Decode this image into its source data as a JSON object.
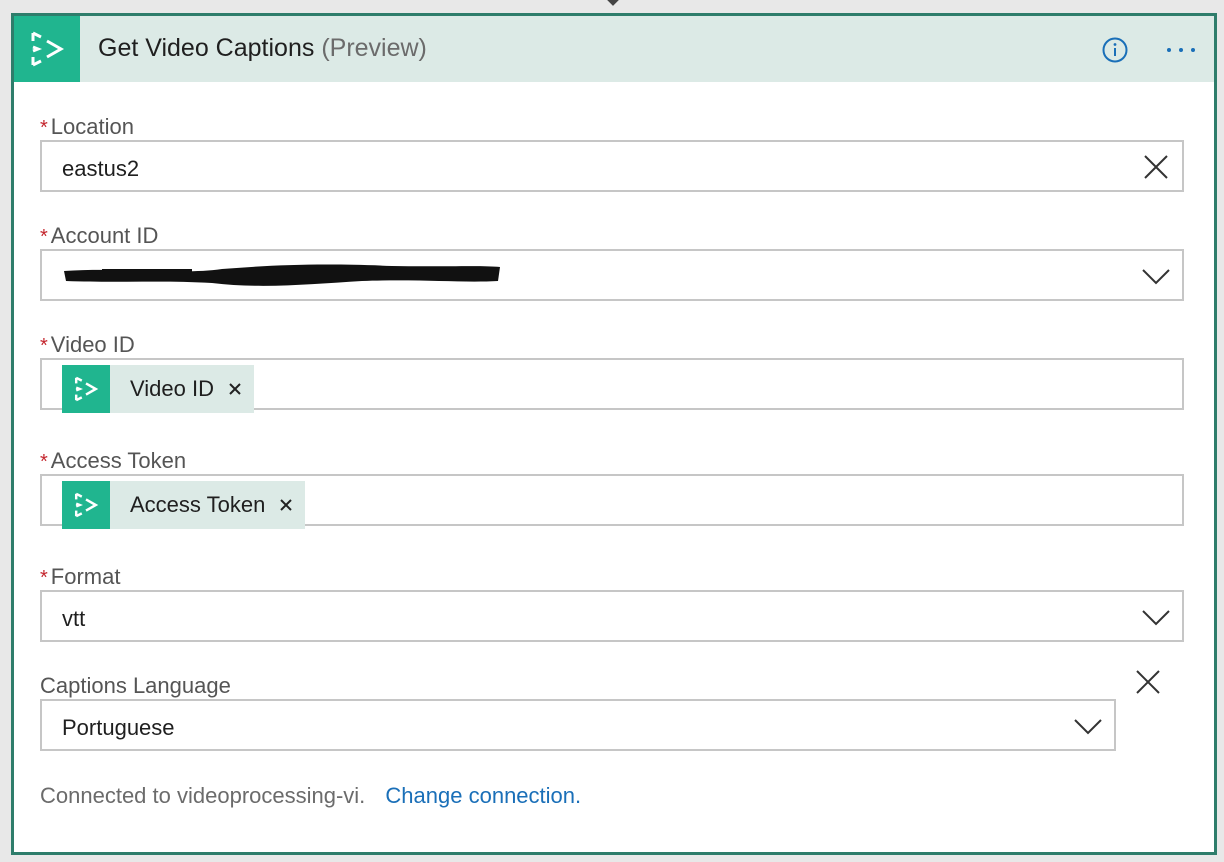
{
  "header": {
    "title": "Get Video Captions",
    "subtitle": "(Preview)",
    "logo_icon": "video-indexer-icon",
    "info_icon": "info-icon",
    "more_icon": "more-options-icon"
  },
  "fields": {
    "location": {
      "required_mark": "*",
      "label": "Location",
      "value": "eastus2",
      "action_icon": "clear-icon"
    },
    "account_id": {
      "required_mark": "*",
      "label": "Account ID",
      "value_redacted": true,
      "action_icon": "chevron-down-icon"
    },
    "video_id": {
      "required_mark": "*",
      "label": "Video ID",
      "token_label": "Video ID",
      "token_icon": "video-indexer-icon"
    },
    "access_token": {
      "required_mark": "*",
      "label": "Access Token",
      "token_label": "Access Token",
      "token_icon": "video-indexer-icon"
    },
    "format": {
      "required_mark": "*",
      "label": "Format",
      "value": "vtt",
      "action_icon": "chevron-down-icon"
    },
    "captions_language": {
      "label": "Captions Language",
      "value": "Portuguese",
      "action_icon": "chevron-down-icon",
      "remove_icon": "close-icon"
    }
  },
  "footer": {
    "connection_text": "Connected to videoprocessing-vi.",
    "change_link": "Change connection."
  },
  "colors": {
    "accent": "#20b58f",
    "border": "#2e7d6b",
    "header_bg": "#dceae6",
    "required": "#c4262e",
    "link": "#1a6fb8"
  }
}
